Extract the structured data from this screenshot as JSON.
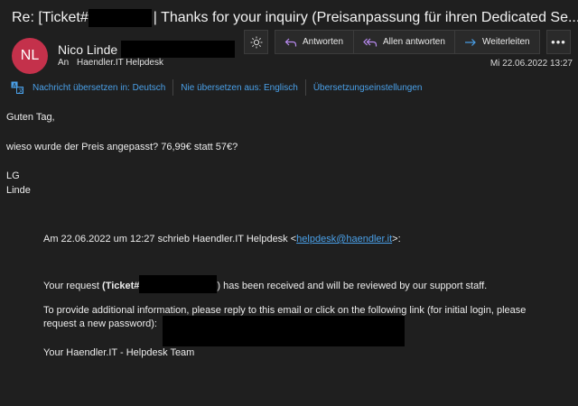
{
  "subject": {
    "prefix": "Re: [Ticket#",
    "suffix": "| Thanks for your inquiry (Preisanpassung für ihren Dedicated Se..."
  },
  "sender": {
    "initials": "NL",
    "avatar_color": "#c4314b",
    "name": "Nico Linde",
    "to_label": "An",
    "recipient": "Haendler.IT Helpdesk"
  },
  "toolbar": {
    "theme_icon": "sun-icon",
    "reply_label": "Antworten",
    "reply_all_label": "Allen antworten",
    "forward_label": "Weiterleiten",
    "more_label": "•••",
    "accent_color": "#b98bf0",
    "forward_color": "#4aa0e8"
  },
  "timestamp": "Mi 22.06.2022 13:27",
  "translate": {
    "translate_label": "Nachricht übersetzen in: Deutsch",
    "never_label": "Nie übersetzen aus: Englisch",
    "settings_label": "Übersetzungseinstellungen",
    "link_color": "#4aa0e8"
  },
  "body": {
    "greeting": "Guten Tag,",
    "question": "wieso wurde der Preis angepasst? 76,99€ statt 57€?",
    "closing1": "LG",
    "closing2": "Linde"
  },
  "quoted": {
    "header_prefix": "Am 22.06.2022 um 12:27 schrieb Haendler.IT Helpdesk <",
    "header_email": "helpdesk@haendler.it",
    "header_suffix": ">:",
    "request_prefix": "Your request ",
    "request_bold": "(Ticket#",
    "request_suffix": ") has been received and will be reviewed by our support staff.",
    "info_line1": "To provide additional information, please reply to this email or click on the following link (for initial login, please",
    "info_line2": "request a new password):",
    "signature": "Your Haendler.IT - Helpdesk Team"
  }
}
